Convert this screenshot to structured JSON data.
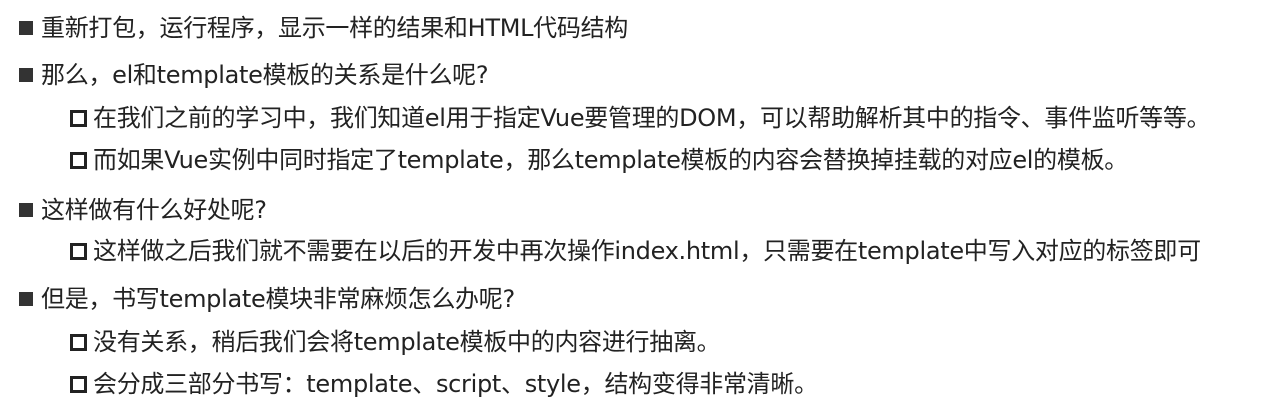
{
  "items": [
    {
      "level": 1,
      "text": "重新打包，运行程序，显示一样的结果和HTML代码结构"
    },
    {
      "level": 1,
      "text": "那么，el和template模板的关系是什么呢?"
    },
    {
      "level": 2,
      "text": "在我们之前的学习中，我们知道el用于指定Vue要管理的DOM，可以帮助解析其中的指令、事件监听等等。"
    },
    {
      "level": 2,
      "text": "而如果Vue实例中同时指定了template，那么template模板的内容会替换掉挂载的对应el的模板。"
    },
    {
      "level": 1,
      "text": "这样做有什么好处呢?"
    },
    {
      "level": 2,
      "text": "这样做之后我们就不需要在以后的开发中再次操作index.html，只需要在template中写入对应的标签即可"
    },
    {
      "level": 1,
      "text": "但是，书写template模块非常麻烦怎么办呢?"
    },
    {
      "level": 2,
      "text": "没有关系，稍后我们会将template模板中的内容进行抽离。"
    },
    {
      "level": 2,
      "text": "会分成三部分书写：template、script、style，结构变得非常清晰。"
    }
  ],
  "colors": {
    "text": "#222222",
    "bullet": "#333333",
    "background": "#ffffff"
  },
  "icons": {
    "level1_bullet": "filled-square-bullet-icon",
    "level2_bullet": "hollow-square-bullet-icon"
  }
}
